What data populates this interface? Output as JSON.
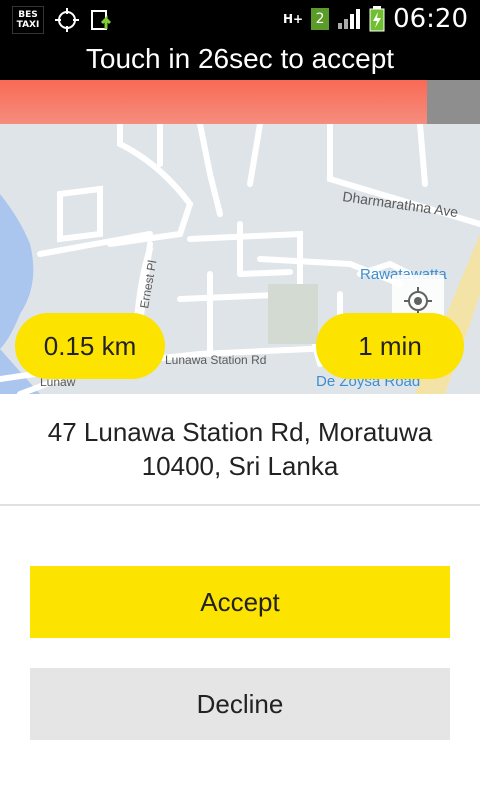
{
  "status_bar": {
    "time": "06:20",
    "network": "H+",
    "sim": "2",
    "app_badge_line1": "BES",
    "app_badge_line2": "TAXI"
  },
  "header": {
    "prompt": "Touch in 26sec to accept"
  },
  "countdown": {
    "fraction_remaining": 0.89,
    "fill_color": "#f97a66",
    "track_color": "#8e8e8e"
  },
  "map": {
    "street_labels": [
      "Dharmarathna Ave",
      "Ernest Pl",
      "Rawatawatta",
      "De Zoysa Road",
      "Lunawa Station Rd",
      "Lunaw"
    ],
    "distance": "0.15 km",
    "eta": "1 min"
  },
  "pickup": {
    "address": "47 Lunawa Station Rd, Moratuwa 10400, Sri Lanka"
  },
  "actions": {
    "accept": "Accept",
    "decline": "Decline"
  },
  "colors": {
    "accent": "#fde300",
    "decline_bg": "#e5e5e5"
  }
}
